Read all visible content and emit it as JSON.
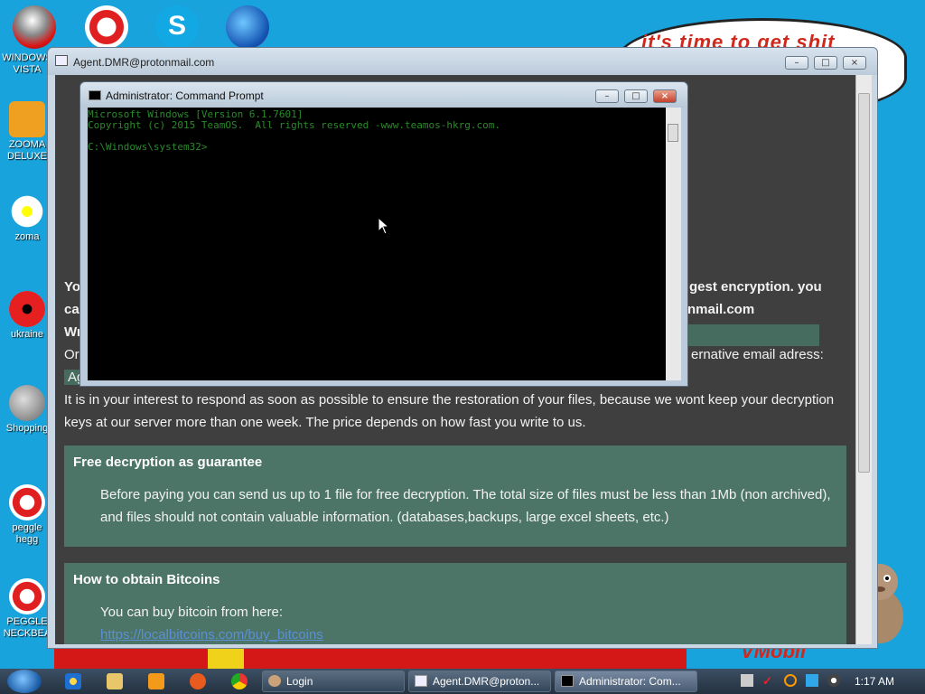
{
  "desktop": {
    "speech_text": "it's time to get shit",
    "banner_text": "VMobil",
    "icons": [
      {
        "label": "WINDOWS VISTA"
      },
      {
        "label": "ZOOMA DELUXE"
      },
      {
        "label": "zoma"
      },
      {
        "label": "ukraine"
      },
      {
        "label": "Shopping"
      },
      {
        "label": "peggle hegg"
      },
      {
        "label": "PEGGLE NECKBEA"
      }
    ]
  },
  "main_window": {
    "title": "Agent.DMR@protonmail.com",
    "buttons": {
      "minimize": "–",
      "maximize": "□",
      "close": "×"
    },
    "content": {
      "line1": "Yo",
      "line1_right": "gest encryption. you",
      "line2": "ca",
      "line2_right": "nmail.com",
      "line3": "Wr",
      "line4": "Or",
      "line4_right": "ernative email adress:",
      "line5": "Ag",
      "paragraph_1": "It is in your interest to respond as soon as possible to ensure the restoration of your files, because we wont keep your decryption",
      "paragraph_2": "keys at our server more than one week. The price depends on how fast you write to us.",
      "card1": {
        "title": "Free decryption as guarantee",
        "line1": "Before paying you can send us up to 1 file for free decryption. The total size of files must be less than 1Mb (non archived),",
        "line2": "and files should not contain valuable information. (databases,backups, large excel sheets, etc.)"
      },
      "card2": {
        "title": "How to obtain Bitcoins",
        "line1": "You can buy bitcoin from here:",
        "link": "https://localbitcoins.com/buy_bitcoins"
      }
    }
  },
  "cmd_window": {
    "title": "Administrator: Command Prompt",
    "lines": [
      "Microsoft Windows [Version 6.1.7601]",
      "Copyright (c) 2015 TeamOS.  All rights reserved -www.teamos-hkrg.com.",
      "",
      "C:\\Windows\\system32>"
    ]
  },
  "taskbar": {
    "buttons": [
      {
        "label": "Login"
      },
      {
        "label": "Agent.DMR@proton..."
      },
      {
        "label": "Administrator: Com..."
      }
    ],
    "time": "1:17 AM"
  }
}
